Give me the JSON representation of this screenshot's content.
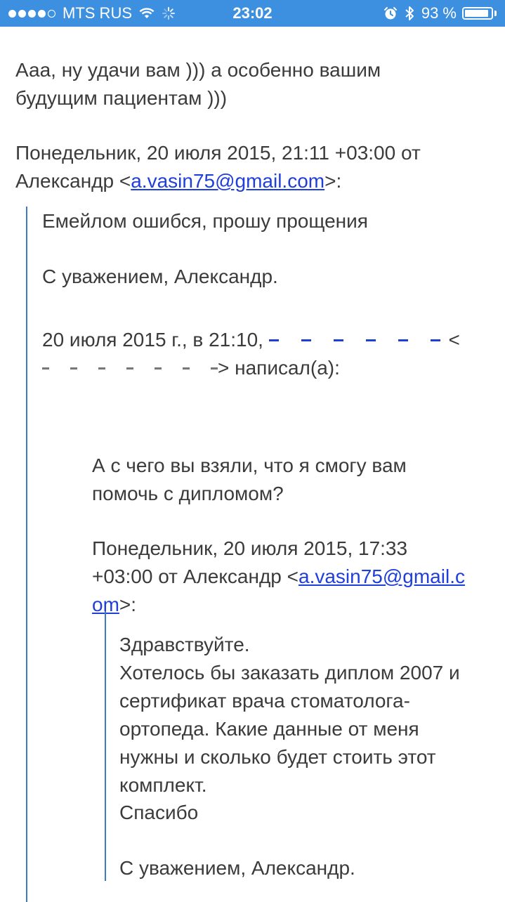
{
  "status_bar": {
    "carrier": "MTS RUS",
    "signal_bars_filled": 4,
    "signal_bars_total": 5,
    "time": "23:02",
    "battery_percent": "93 %",
    "battery_level": 0.93,
    "icons": [
      "wifi-icon",
      "activity-spinner-icon",
      "alarm-icon",
      "bluetooth-icon",
      "battery-icon"
    ]
  },
  "message": {
    "reply_lines": [
      "Ааа, ну удачи вам ))) а особенно вашим",
      "будущим пациентам )))"
    ],
    "header1": {
      "line1": "Понедельник, 20 июля 2015, 21:11 +03:00 от",
      "line2_prefix": "Александр <",
      "email": "a.vasin75@gmail.com",
      "line2_suffix": ">:"
    },
    "quote1": {
      "line1": "Емейлом ошибся, прошу прощения",
      "line2": "С уважением, Александр.",
      "attr_prefix": "20 июля 2015 г., в 21:10,",
      "attr_tail": "<",
      "wrote_suffix": "> написал(а):",
      "question_lines": [
        "А с чего вы взяли, что я смогу вам",
        "помочь с дипломом?"
      ],
      "header2": {
        "line1": "Понедельник, 20 июля 2015, 17:33",
        "line2_prefix": "+03:00 от Александр <",
        "email_part1": "a.vasin75@gmail.c",
        "email_part2": "om",
        "line3_suffix": ">:"
      },
      "quote2_lines": [
        "Здравствуйте.",
        "Хотелось бы заказать диплом 2007 и",
        "сертификат врача стоматолога-",
        "ортопеда. Какие данные от меня",
        "нужны и сколько будет стоить этот",
        "комплект.",
        "Спасибо",
        "",
        "С уважением, Александр."
      ]
    }
  },
  "colors": {
    "status_bar_bg": "#3d8fe0",
    "text": "#3b3b3b",
    "link": "#1f3fd9",
    "quote_bar": "#3d7ac8"
  }
}
